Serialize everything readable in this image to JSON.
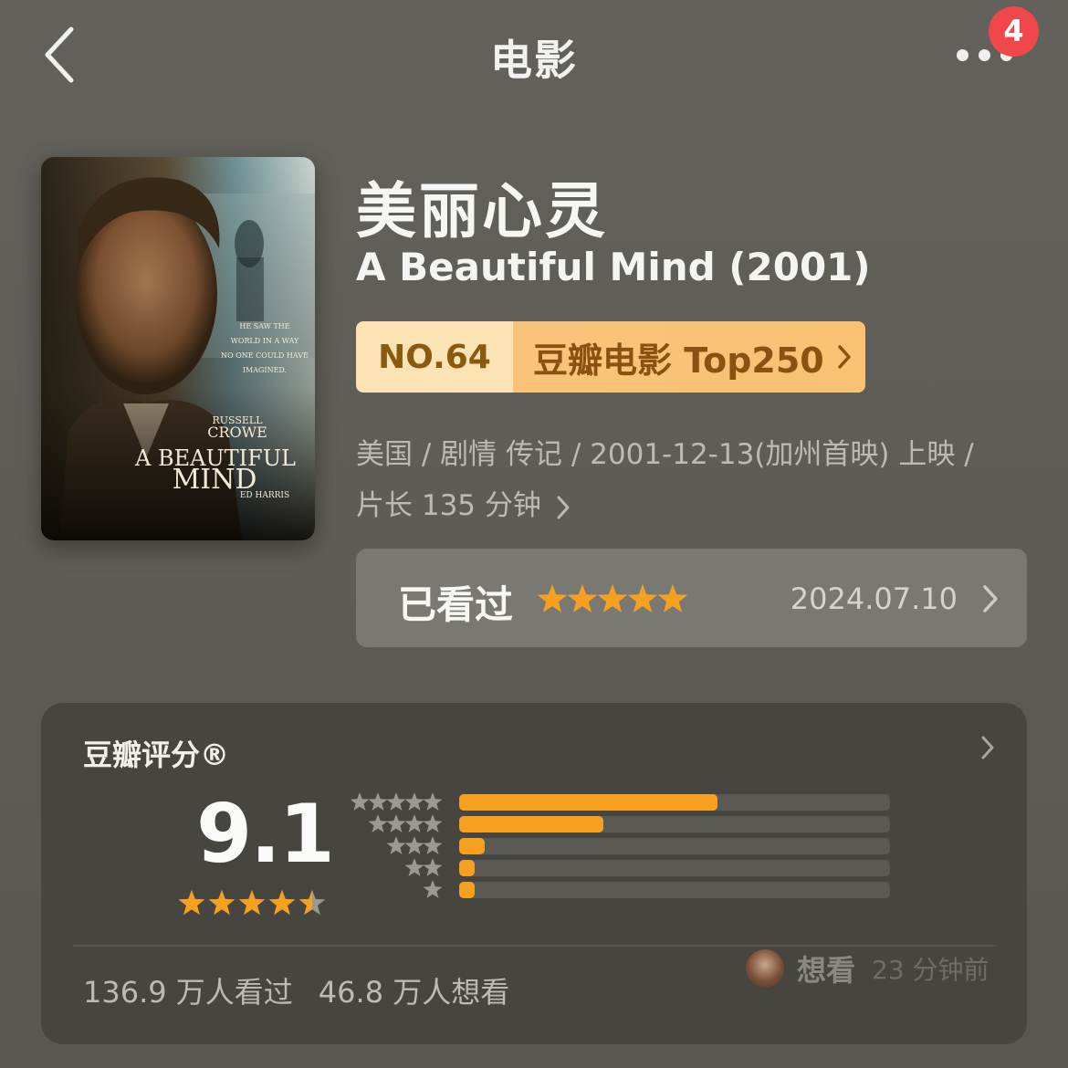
{
  "header": {
    "title": "电影",
    "badge_count": "4"
  },
  "movie": {
    "title_cn": "美丽心灵",
    "title_en": "A Beautiful Mind (2001)",
    "poster_text": {
      "tagline": [
        "HE SAW THE",
        "WORLD IN A WAY",
        "NO ONE COULD HAVE",
        "IMAGINED."
      ],
      "actor_first": "RUSSELL",
      "actor_last": "CROWE",
      "film_a": "A BEAUTIFUL",
      "film_b": "MIND",
      "costar": "ED HARRIS"
    },
    "rank": {
      "number": "NO.64",
      "list_name": "豆瓣电影 Top250"
    },
    "meta_line1": "美国 / 剧情 传记 / 2001-12-13(加州首映) 上映 /",
    "meta_line2": "片长 135 分钟"
  },
  "watched": {
    "label": "已看过",
    "stars": 5,
    "date": "2024.07.10"
  },
  "rating": {
    "title": "豆瓣评分®",
    "score": "9.1",
    "score_stars": 4.5,
    "distribution": [
      {
        "stars": 5,
        "fraction": 0.6
      },
      {
        "stars": 4,
        "fraction": 0.335
      },
      {
        "stars": 3,
        "fraction": 0.06
      },
      {
        "stars": 2,
        "fraction": 0.035
      },
      {
        "stars": 1,
        "fraction": 0.035
      }
    ],
    "watched_count": "136.9 万人看过",
    "wish_count": "46.8 万人想看",
    "friend_action": "想看",
    "friend_time": "23 分钟前"
  },
  "colors": {
    "star": "#f6a020",
    "star_dim": "#9a988f",
    "bar": "#f6a020",
    "badge": "#f0484a"
  }
}
